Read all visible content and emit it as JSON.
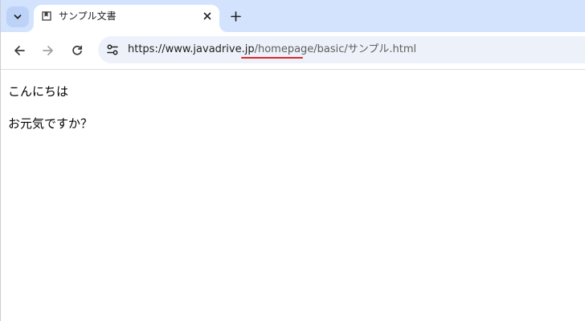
{
  "tab": {
    "title": "サンプル文書",
    "favicon": "document-icon"
  },
  "toolbar": {
    "back_icon": "back-arrow-icon",
    "forward_icon": "forward-arrow-icon",
    "reload_icon": "reload-icon"
  },
  "omnibox": {
    "url_host": "https://www.javadrive.jp",
    "url_path_prefix": "/homepage/basic/",
    "url_highlight": "サンプル.html",
    "highlight_color": "#e0262b"
  },
  "content": {
    "paragraphs": [
      "こんにちは",
      "お元気ですか？"
    ]
  },
  "colors": {
    "tabstrip": "#d3e3fd",
    "omnibox": "#edf2fa"
  }
}
